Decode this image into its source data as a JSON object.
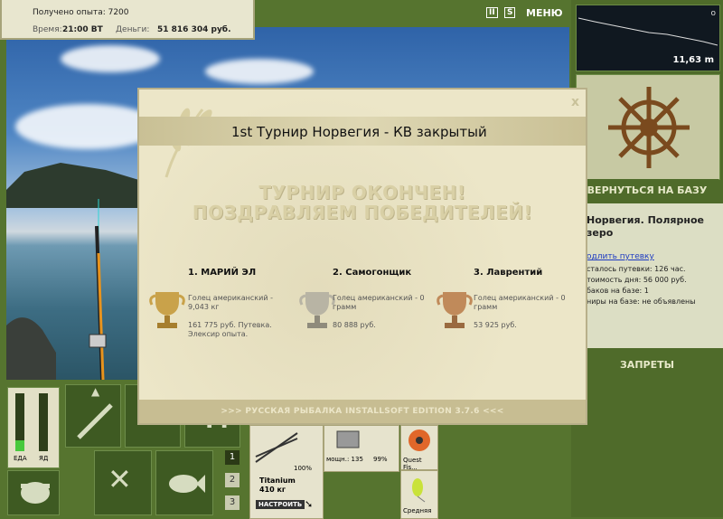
{
  "stats": {
    "experience": "Получено опыта: 7200",
    "time_label": "Время:",
    "time_value": "21:00 ВТ",
    "money_label": "Деньги:",
    "money_value": "51 816 304 руб."
  },
  "topbar": {
    "pause": "II",
    "sound": "S",
    "menu": "МЕНЮ"
  },
  "depth": {
    "value": "11,63 m",
    "marker": "o"
  },
  "right_panel": {
    "return_button": "ВЕРНУТЬСЯ НА БАЗУ",
    "location_line1": "Норвегия. Полярное",
    "location_line2": "зеро",
    "extend_link": "одлить путевку",
    "trip_left": "сталось путевки: 126 час.",
    "day_cost": "тоимость дня: 56 000 руб.",
    "tanks": "баков на базе: 1",
    "tournaments": "ниры на базе: не объявлены",
    "bans_button": "ЗАПРЕТЫ"
  },
  "bottom": {
    "eda": "ЕДА",
    "yad": "ЯД",
    "slot1": "1",
    "slot2": "2",
    "slot3": "3",
    "rod_name": "Titanium",
    "rod_weight": "410 кг",
    "rod_percent": "100%",
    "setup_button": "НАСТРОИТЬ",
    "reel_power": "мощн.: 135",
    "reel_percent": "99%",
    "line_name": "Quest Fis...",
    "lure_name": "Средняя"
  },
  "dialog": {
    "title": "1st Турнир Норвегия - КВ закрытый",
    "close": "x",
    "headline1": "ТУРНИР ОКОНЧЕН!",
    "headline2": "ПОЗДРАВЛЯЕМ ПОБЕДИТЕЛЕЙ!",
    "winners": [
      {
        "name": "1. МАРИЙ ЭЛ",
        "fish": "Голец американский - 9,043 кг",
        "prize": "161 775 руб. Путевка. Элексир опыта."
      },
      {
        "name": "2. Самогонщик",
        "fish": "Голец американский - 0 грамм",
        "prize": "80 888 руб."
      },
      {
        "name": "3. Лаврентий",
        "fish": "Голец американский - 0 грамм",
        "prize": "53 925 руб."
      }
    ],
    "footer": ">>> РУССКАЯ РЫБАЛКА INSTALLSOFT EDITION 3.7.6 <<<"
  },
  "colors": {
    "gold": "#c9a24a",
    "silver": "#b8b4a4",
    "bronze": "#c08a5a",
    "panel_green": "#4f6b2a"
  }
}
